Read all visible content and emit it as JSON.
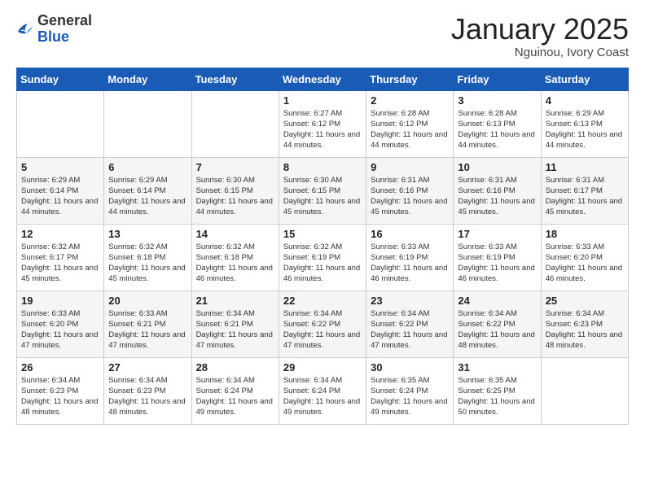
{
  "logo": {
    "general": "General",
    "blue": "Blue"
  },
  "header": {
    "month": "January 2025",
    "location": "Nguinou, Ivory Coast"
  },
  "weekdays": [
    "Sunday",
    "Monday",
    "Tuesday",
    "Wednesday",
    "Thursday",
    "Friday",
    "Saturday"
  ],
  "weeks": [
    [
      {
        "day": "",
        "info": ""
      },
      {
        "day": "",
        "info": ""
      },
      {
        "day": "",
        "info": ""
      },
      {
        "day": "1",
        "info": "Sunrise: 6:27 AM\nSunset: 6:12 PM\nDaylight: 11 hours and 44 minutes."
      },
      {
        "day": "2",
        "info": "Sunrise: 6:28 AM\nSunset: 6:12 PM\nDaylight: 11 hours and 44 minutes."
      },
      {
        "day": "3",
        "info": "Sunrise: 6:28 AM\nSunset: 6:13 PM\nDaylight: 11 hours and 44 minutes."
      },
      {
        "day": "4",
        "info": "Sunrise: 6:29 AM\nSunset: 6:13 PM\nDaylight: 11 hours and 44 minutes."
      }
    ],
    [
      {
        "day": "5",
        "info": "Sunrise: 6:29 AM\nSunset: 6:14 PM\nDaylight: 11 hours and 44 minutes."
      },
      {
        "day": "6",
        "info": "Sunrise: 6:29 AM\nSunset: 6:14 PM\nDaylight: 11 hours and 44 minutes."
      },
      {
        "day": "7",
        "info": "Sunrise: 6:30 AM\nSunset: 6:15 PM\nDaylight: 11 hours and 44 minutes."
      },
      {
        "day": "8",
        "info": "Sunrise: 6:30 AM\nSunset: 6:15 PM\nDaylight: 11 hours and 45 minutes."
      },
      {
        "day": "9",
        "info": "Sunrise: 6:31 AM\nSunset: 6:16 PM\nDaylight: 11 hours and 45 minutes."
      },
      {
        "day": "10",
        "info": "Sunrise: 6:31 AM\nSunset: 6:16 PM\nDaylight: 11 hours and 45 minutes."
      },
      {
        "day": "11",
        "info": "Sunrise: 6:31 AM\nSunset: 6:17 PM\nDaylight: 11 hours and 45 minutes."
      }
    ],
    [
      {
        "day": "12",
        "info": "Sunrise: 6:32 AM\nSunset: 6:17 PM\nDaylight: 11 hours and 45 minutes."
      },
      {
        "day": "13",
        "info": "Sunrise: 6:32 AM\nSunset: 6:18 PM\nDaylight: 11 hours and 45 minutes."
      },
      {
        "day": "14",
        "info": "Sunrise: 6:32 AM\nSunset: 6:18 PM\nDaylight: 11 hours and 46 minutes."
      },
      {
        "day": "15",
        "info": "Sunrise: 6:32 AM\nSunset: 6:19 PM\nDaylight: 11 hours and 46 minutes."
      },
      {
        "day": "16",
        "info": "Sunrise: 6:33 AM\nSunset: 6:19 PM\nDaylight: 11 hours and 46 minutes."
      },
      {
        "day": "17",
        "info": "Sunrise: 6:33 AM\nSunset: 6:19 PM\nDaylight: 11 hours and 46 minutes."
      },
      {
        "day": "18",
        "info": "Sunrise: 6:33 AM\nSunset: 6:20 PM\nDaylight: 11 hours and 46 minutes."
      }
    ],
    [
      {
        "day": "19",
        "info": "Sunrise: 6:33 AM\nSunset: 6:20 PM\nDaylight: 11 hours and 47 minutes."
      },
      {
        "day": "20",
        "info": "Sunrise: 6:33 AM\nSunset: 6:21 PM\nDaylight: 11 hours and 47 minutes."
      },
      {
        "day": "21",
        "info": "Sunrise: 6:34 AM\nSunset: 6:21 PM\nDaylight: 11 hours and 47 minutes."
      },
      {
        "day": "22",
        "info": "Sunrise: 6:34 AM\nSunset: 6:22 PM\nDaylight: 11 hours and 47 minutes."
      },
      {
        "day": "23",
        "info": "Sunrise: 6:34 AM\nSunset: 6:22 PM\nDaylight: 11 hours and 47 minutes."
      },
      {
        "day": "24",
        "info": "Sunrise: 6:34 AM\nSunset: 6:22 PM\nDaylight: 11 hours and 48 minutes."
      },
      {
        "day": "25",
        "info": "Sunrise: 6:34 AM\nSunset: 6:23 PM\nDaylight: 11 hours and 48 minutes."
      }
    ],
    [
      {
        "day": "26",
        "info": "Sunrise: 6:34 AM\nSunset: 6:23 PM\nDaylight: 11 hours and 48 minutes."
      },
      {
        "day": "27",
        "info": "Sunrise: 6:34 AM\nSunset: 6:23 PM\nDaylight: 11 hours and 48 minutes."
      },
      {
        "day": "28",
        "info": "Sunrise: 6:34 AM\nSunset: 6:24 PM\nDaylight: 11 hours and 49 minutes."
      },
      {
        "day": "29",
        "info": "Sunrise: 6:34 AM\nSunset: 6:24 PM\nDaylight: 11 hours and 49 minutes."
      },
      {
        "day": "30",
        "info": "Sunrise: 6:35 AM\nSunset: 6:24 PM\nDaylight: 11 hours and 49 minutes."
      },
      {
        "day": "31",
        "info": "Sunrise: 6:35 AM\nSunset: 6:25 PM\nDaylight: 11 hours and 50 minutes."
      },
      {
        "day": "",
        "info": ""
      }
    ]
  ]
}
